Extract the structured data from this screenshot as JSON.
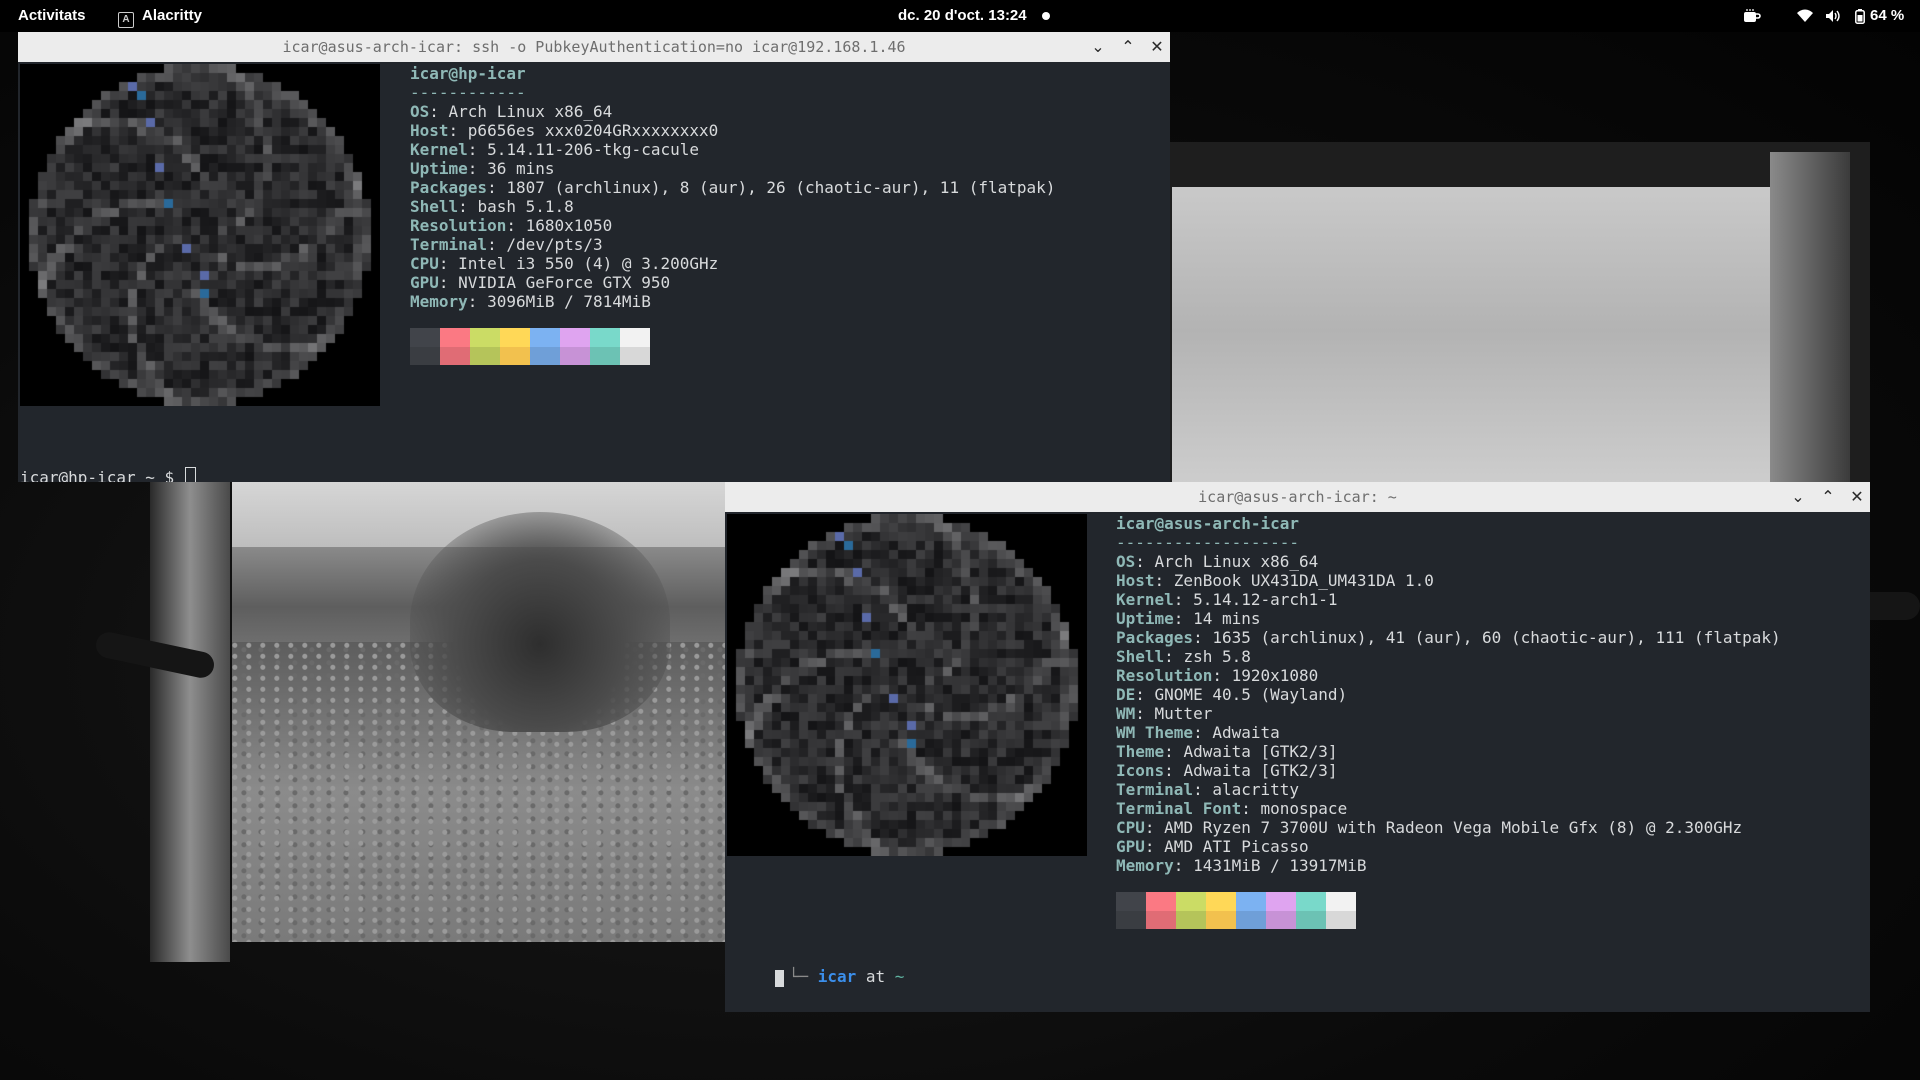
{
  "topbar": {
    "activities": "Activitats",
    "app_name": "Alacritty",
    "clock": "dc. 20 d'oct.  13:24",
    "battery": "64 %"
  },
  "term1": {
    "title": "icar@asus-arch-icar: ssh -o PubkeyAuthentication=no icar@192.168.1.46",
    "header": "icar@hp-icar",
    "separator": "------------",
    "info": [
      {
        "key": "OS",
        "value": "Arch Linux x86_64"
      },
      {
        "key": "Host",
        "value": "p6656es xxx0204GRxxxxxxxx0"
      },
      {
        "key": "Kernel",
        "value": "5.14.11-206-tkg-cacule"
      },
      {
        "key": "Uptime",
        "value": "36 mins"
      },
      {
        "key": "Packages",
        "value": "1807 (archlinux), 8 (aur), 26 (chaotic-aur), 11 (flatpak)"
      },
      {
        "key": "Shell",
        "value": "bash 5.1.8"
      },
      {
        "key": "Resolution",
        "value": "1680x1050"
      },
      {
        "key": "Terminal",
        "value": "/dev/pts/3"
      },
      {
        "key": "CPU",
        "value": "Intel i3 550 (4) @ 3.200GHz"
      },
      {
        "key": "GPU",
        "value": "NVIDIA GeForce GTX 950"
      },
      {
        "key": "Memory",
        "value": "3096MiB / 7814MiB"
      }
    ],
    "prompt": "icar@hp-icar ~ $ "
  },
  "term2": {
    "title": "icar@asus-arch-icar: ~",
    "header": "icar@asus-arch-icar",
    "separator": "-------------------",
    "info": [
      {
        "key": "OS",
        "value": "Arch Linux x86_64"
      },
      {
        "key": "Host",
        "value": "ZenBook UX431DA_UM431DA 1.0"
      },
      {
        "key": "Kernel",
        "value": "5.14.12-arch1-1"
      },
      {
        "key": "Uptime",
        "value": "14 mins"
      },
      {
        "key": "Packages",
        "value": "1635 (archlinux), 41 (aur), 60 (chaotic-aur), 111 (flatpak)"
      },
      {
        "key": "Shell",
        "value": "zsh 5.8"
      },
      {
        "key": "Resolution",
        "value": "1920x1080"
      },
      {
        "key": "DE",
        "value": "GNOME 40.5 (Wayland)"
      },
      {
        "key": "WM",
        "value": "Mutter"
      },
      {
        "key": "WM Theme",
        "value": "Adwaita"
      },
      {
        "key": "Theme",
        "value": "Adwaita [GTK2/3]"
      },
      {
        "key": "Icons",
        "value": "Adwaita [GTK2/3]"
      },
      {
        "key": "Terminal",
        "value": "alacritty"
      },
      {
        "key": "Terminal Font",
        "value": "monospace"
      },
      {
        "key": "CPU",
        "value": "AMD Ryzen 7 3700U with Radeon Vega Mobile Gfx (8) @ 2.300GHz"
      },
      {
        "key": "GPU",
        "value": "AMD ATI Picasso"
      },
      {
        "key": "Memory",
        "value": "1431MiB / 13917MiB"
      }
    ],
    "prompt_user": "icar",
    "prompt_at": "at",
    "prompt_dir": "~"
  },
  "palette_colors": [
    "#22262c",
    "#e06c75",
    "#b5c45a",
    "#f2c14e",
    "#6f9fd8",
    "#c792d6",
    "#6cc2b4",
    "#d8d8d8"
  ],
  "colors": {
    "terminal_bg": "#22262c",
    "terminal_fg": "#d8dadc",
    "key": "#8fb8b6",
    "prompt_user": "#3b8eea",
    "prompt_dir": "#5fb3a1"
  }
}
